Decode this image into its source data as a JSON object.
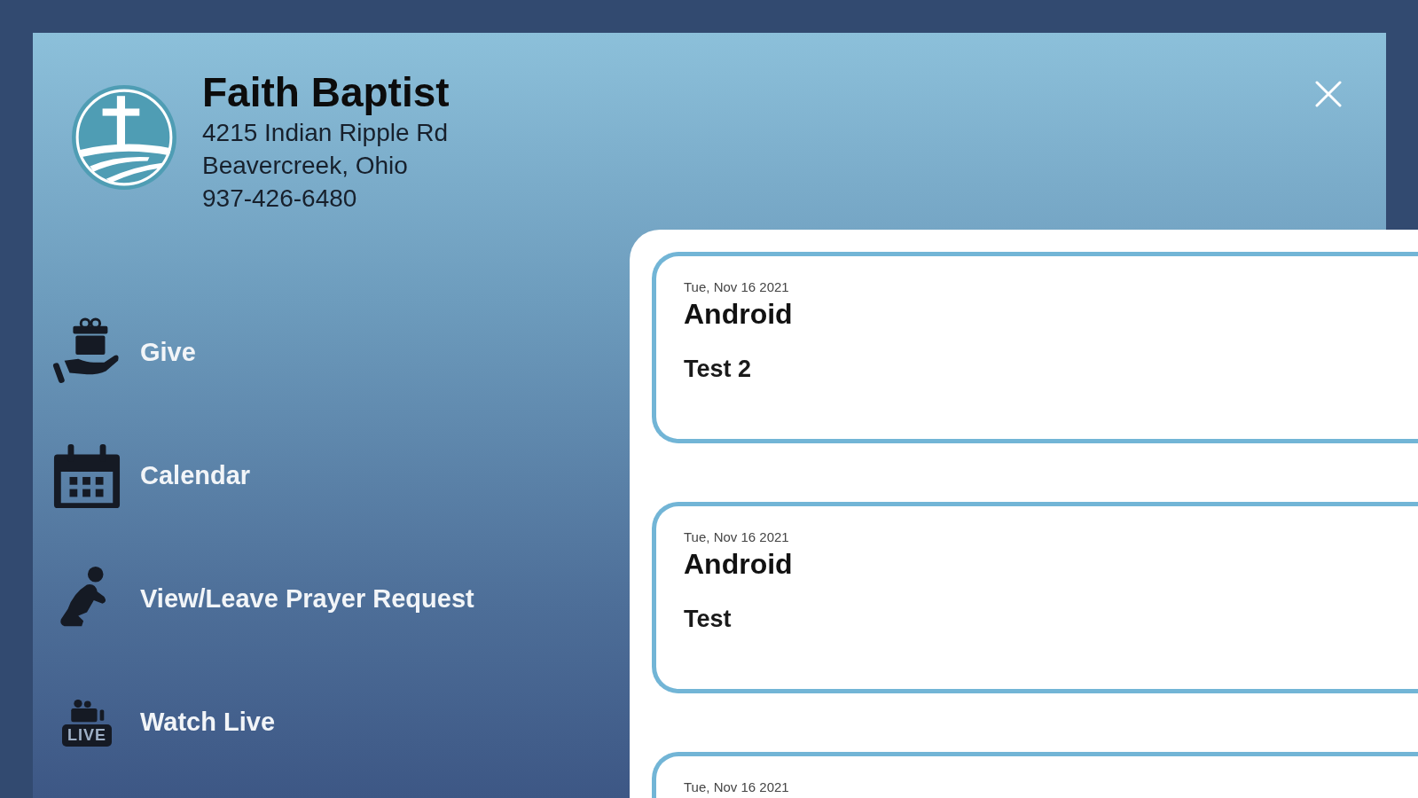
{
  "church": {
    "name": "Faith Baptist",
    "address_lines": [
      "4215 Indian Ripple Rd",
      "Beavercreek, Ohio",
      "937-426-6480"
    ]
  },
  "menu": [
    {
      "kind": "give",
      "label": "Give"
    },
    {
      "kind": "calendar",
      "label": "Calendar"
    },
    {
      "kind": "prayer",
      "label": "View/Leave Prayer Request"
    },
    {
      "kind": "live",
      "label": "Watch Live",
      "icon_text": "LIVE"
    }
  ],
  "requests": [
    {
      "date": "Tue, Nov 16 2021",
      "title": "Android",
      "body": "Test 2"
    },
    {
      "date": "Tue, Nov 16 2021",
      "title": "Android",
      "body": "Test"
    },
    {
      "date": "Tue, Nov 16 2021"
    }
  ]
}
